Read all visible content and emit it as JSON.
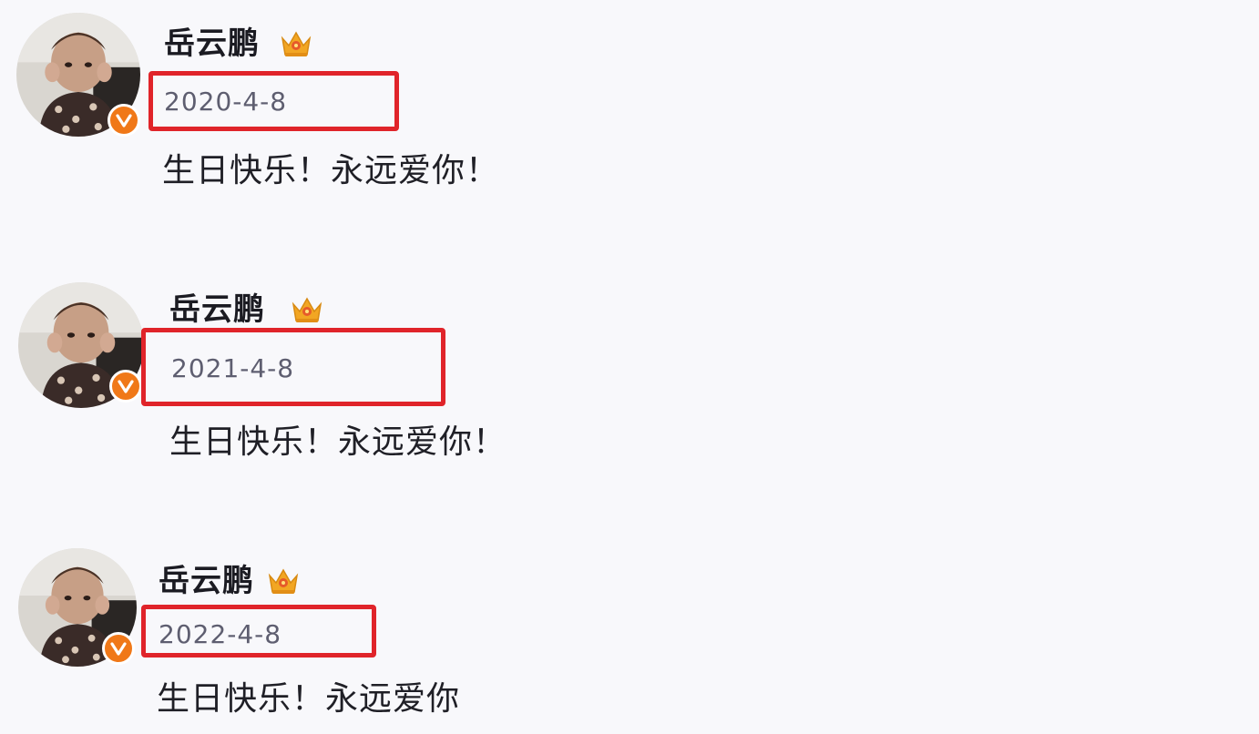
{
  "posts": [
    {
      "username": "岳云鹏",
      "date": "2020-4-8",
      "text": "生日快乐！永远爱你！",
      "avatar_icon": "baby-photo-avatar",
      "verified_icon": "verified-v-badge",
      "level_icon": "crown-icon"
    },
    {
      "username": "岳云鹏",
      "date": "2021-4-8",
      "text": "生日快乐！永远爱你！",
      "avatar_icon": "baby-photo-avatar",
      "verified_icon": "verified-v-badge",
      "level_icon": "crown-icon"
    },
    {
      "username": "岳云鹏",
      "date": "2022-4-8",
      "text": "生日快乐！永远爱你",
      "avatar_icon": "baby-photo-avatar",
      "verified_icon": "verified-v-badge",
      "level_icon": "crown-icon"
    }
  ],
  "colors": {
    "background": "#f8f8fb",
    "highlight_border": "#e0242a",
    "verified_badge": "#f07818",
    "crown": "#f2a623",
    "date_text": "#5e5e70"
  }
}
